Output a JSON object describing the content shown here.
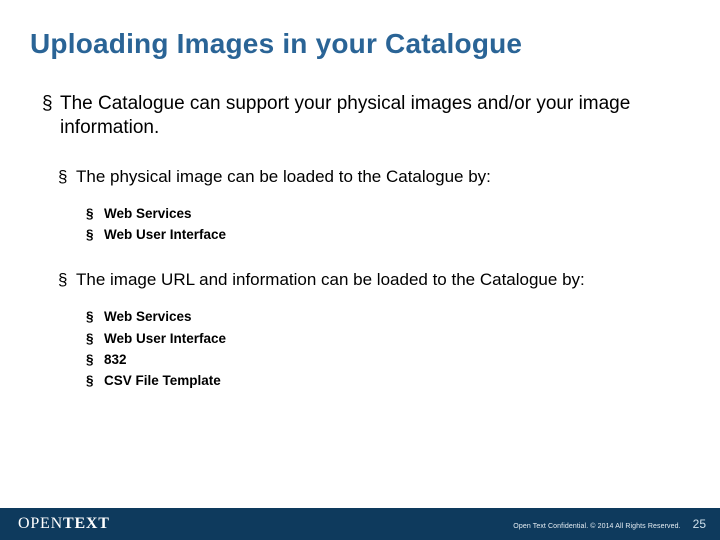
{
  "title": "Uploading Images in your Catalogue",
  "bullets": {
    "main": "The Catalogue can support your physical  images and/or your image information.",
    "physical_intro": "The physical image can be loaded to the Catalogue by:",
    "physical_items": [
      "Web Services",
      "Web User Interface"
    ],
    "url_intro": "The image URL and information can be loaded to the Catalogue by:",
    "url_items": [
      "Web Services",
      "Web User Interface",
      "832",
      "CSV File Template"
    ]
  },
  "footer": {
    "logo_thin": "OPEN",
    "logo_bold": "TEXT",
    "confidential": "Open Text Confidential. © 2014 All Rights Reserved.",
    "page": "25"
  },
  "bullet_char": "§"
}
